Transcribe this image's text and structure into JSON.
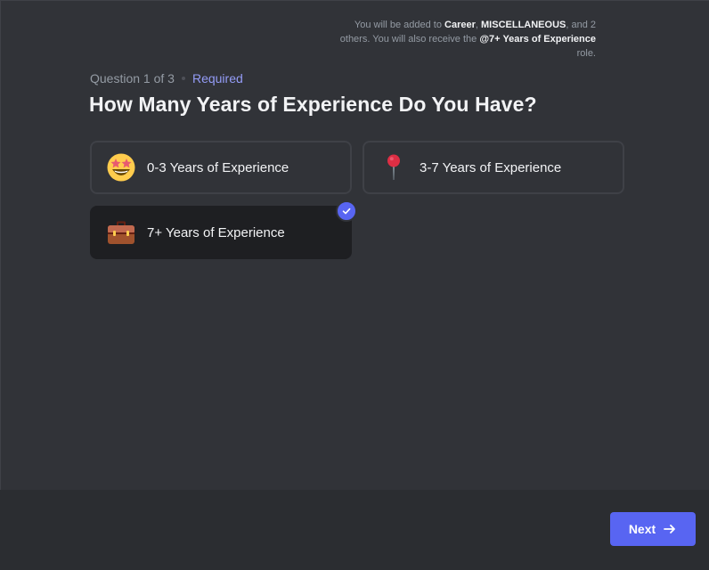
{
  "question": {
    "progress": "Question 1 of 3",
    "required": "Required",
    "title": "How Many Years of Experience Do You Have?"
  },
  "options": [
    {
      "label": "0-3 Years of Experience",
      "icon": "star-struck-emoji-icon",
      "selected": false
    },
    {
      "label": "3-7 Years of Experience",
      "icon": "round-pushpin-icon",
      "selected": false
    },
    {
      "label": "7+ Years of Experience",
      "icon": "briefcase-icon",
      "selected": true
    }
  ],
  "footer": {
    "text_1": "You will be added to ",
    "channel_1": "Career",
    "sep": ", ",
    "channel_2": "MISCELLANEOUS",
    "text_2": ", and 2 others. You will also receive the ",
    "role": "@7+ Years of Experience",
    "text_3": " role."
  },
  "next_button": {
    "label": "Next"
  },
  "colors": {
    "accent": "#5865f2",
    "required": "#949cf7",
    "background": "#313338",
    "footer": "#2b2d31",
    "selected_card": "#1e1f22"
  }
}
